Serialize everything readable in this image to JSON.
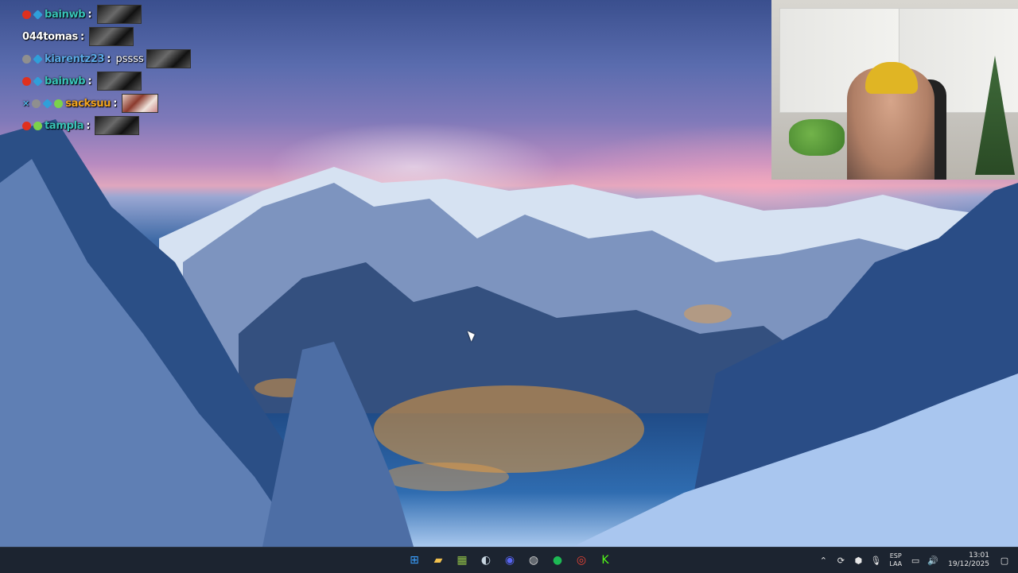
{
  "chat": {
    "messages": [
      {
        "badges": [
          "red",
          "blue"
        ],
        "user": "bainwb",
        "user_color": "teal",
        "text": "",
        "emote": "dark"
      },
      {
        "badges": [],
        "user": "044tomas",
        "user_color": "white",
        "text": "",
        "emote": "dark"
      },
      {
        "badges": [
          "gray",
          "blue"
        ],
        "user": "kiarentz23",
        "user_color": "blue",
        "text": "pssss",
        "emote": "dark"
      },
      {
        "badges": [
          "red",
          "blue"
        ],
        "user": "bainwb",
        "user_color": "teal",
        "text": "",
        "emote": "dark"
      },
      {
        "badges": [
          "x",
          "gray",
          "blue",
          "green"
        ],
        "user": "sacksuu",
        "user_color": "orange",
        "text": "",
        "emote": "light"
      },
      {
        "badges": [
          "red",
          "green"
        ],
        "user": "tampla",
        "user_color": "teal",
        "text": "",
        "emote": "dark"
      }
    ],
    "separator": ":"
  },
  "taskbar": {
    "apps": [
      {
        "name": "windows-start-icon",
        "glyph": "⊞",
        "color": "#3aa0ff"
      },
      {
        "name": "file-explorer-icon",
        "glyph": "▰",
        "color": "#f2c14e"
      },
      {
        "name": "game-launcher-icon",
        "glyph": "▦",
        "color": "#8fbf47"
      },
      {
        "name": "steam-icon",
        "glyph": "◐",
        "color": "#c7d5e0"
      },
      {
        "name": "discord-icon",
        "glyph": "◉",
        "color": "#5865f2"
      },
      {
        "name": "obs-icon",
        "glyph": "◍",
        "color": "#d0d0d0"
      },
      {
        "name": "spotify-icon",
        "glyph": "●",
        "color": "#1db954"
      },
      {
        "name": "chrome-icon",
        "glyph": "◎",
        "color": "#ea4335"
      },
      {
        "name": "kick-icon",
        "glyph": "K",
        "color": "#53fc18"
      }
    ],
    "tray": {
      "lang_top": "ESP",
      "lang_bottom": "LAA",
      "time": "13:01",
      "date": "19/12/2025"
    }
  }
}
